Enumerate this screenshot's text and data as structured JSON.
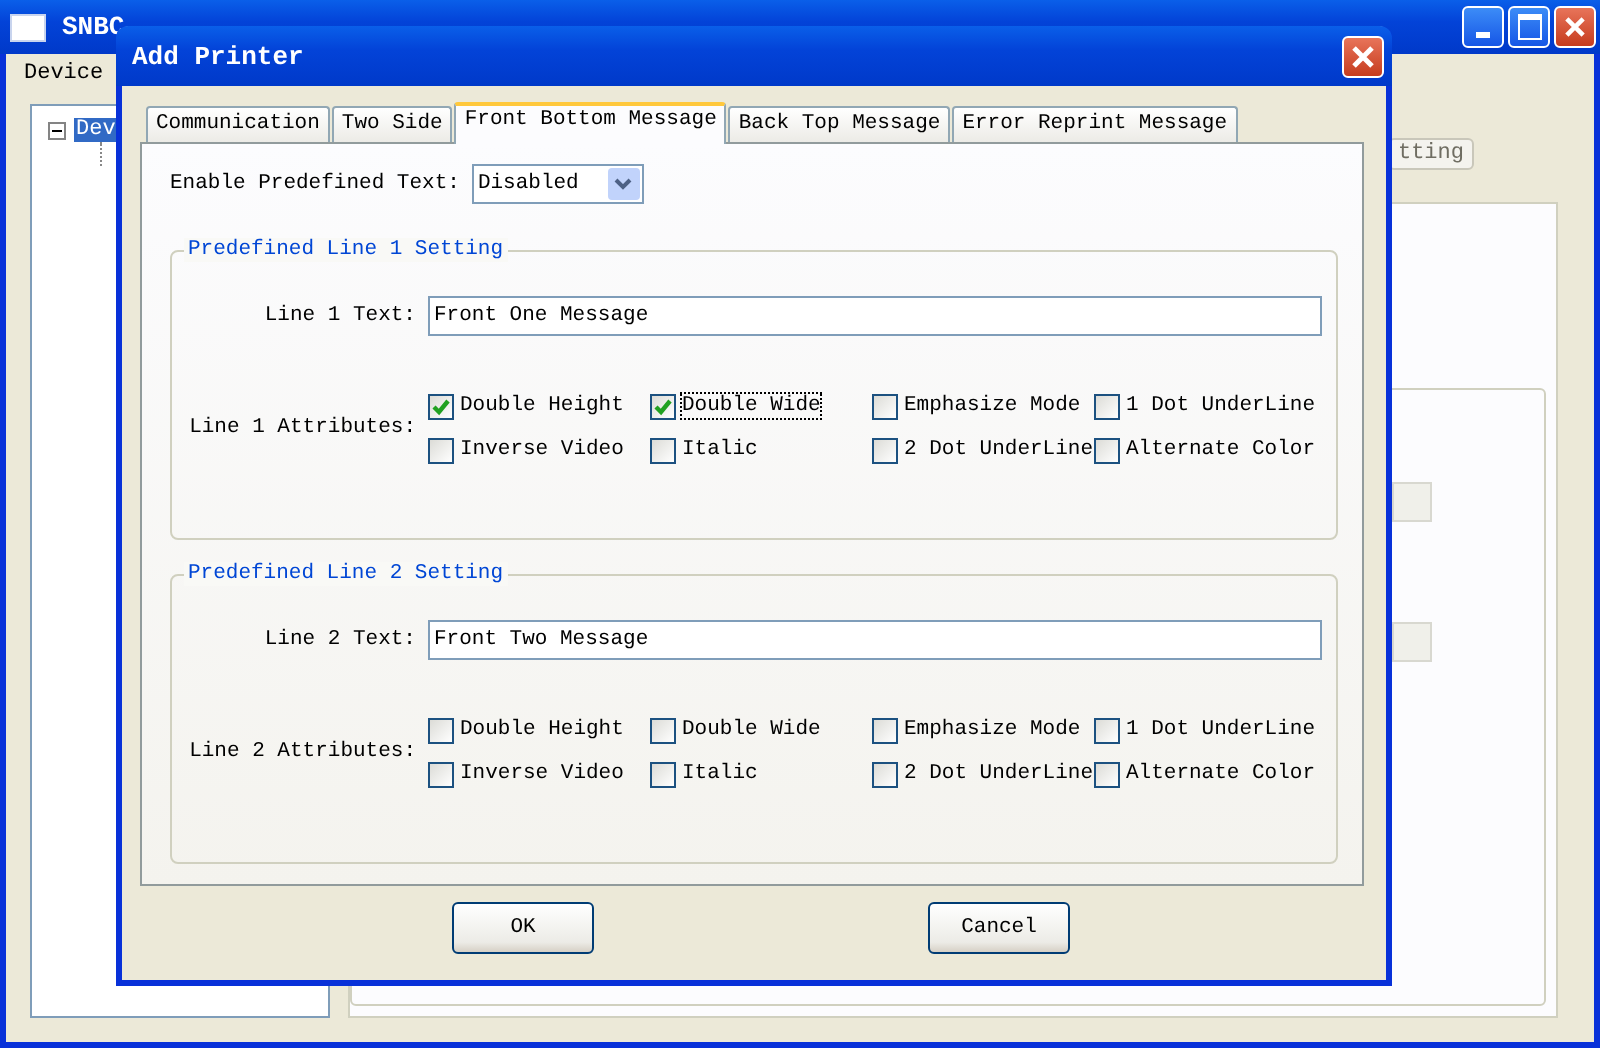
{
  "main_window": {
    "title": "SNBC",
    "menu": [
      "Device"
    ],
    "tree": {
      "label": "Dev",
      "expanded": true,
      "selected": true
    },
    "button_fragment": "tting"
  },
  "dialog": {
    "title": "Add Printer",
    "tabs": [
      {
        "label": "Communication",
        "selected": false
      },
      {
        "label": "Two Side",
        "selected": false
      },
      {
        "label": "Front Bottom Message",
        "selected": true
      },
      {
        "label": "Back Top Message",
        "selected": false
      },
      {
        "label": "Error Reprint Message",
        "selected": false
      }
    ],
    "enable_predefined": {
      "label": "Enable Predefined Text:",
      "value": "Disabled"
    },
    "groups": [
      {
        "title": "Predefined Line 1 Setting",
        "text_label": "Line 1 Text:",
        "text_value": "Front One Message",
        "attributes_label": "Line 1 Attributes:",
        "attributes": [
          {
            "label": "Double Height",
            "checked": true,
            "focused": false
          },
          {
            "label": "Double Wide",
            "checked": true,
            "focused": true
          },
          {
            "label": "Emphasize Mode",
            "checked": false,
            "focused": false
          },
          {
            "label": "1 Dot UnderLine",
            "checked": false,
            "focused": false
          },
          {
            "label": "Inverse Video",
            "checked": false,
            "focused": false
          },
          {
            "label": "Italic",
            "checked": false,
            "focused": false
          },
          {
            "label": "2 Dot UnderLine",
            "checked": false,
            "focused": false
          },
          {
            "label": "Alternate Color",
            "checked": false,
            "focused": false
          }
        ]
      },
      {
        "title": "Predefined Line 2 Setting",
        "text_label": "Line 2 Text:",
        "text_value": "Front Two Message",
        "attributes_label": "Line 2 Attributes:",
        "attributes": [
          {
            "label": "Double Height",
            "checked": false,
            "focused": false
          },
          {
            "label": "Double Wide",
            "checked": false,
            "focused": false
          },
          {
            "label": "Emphasize Mode",
            "checked": false,
            "focused": false
          },
          {
            "label": "1 Dot UnderLine",
            "checked": false,
            "focused": false
          },
          {
            "label": "Inverse Video",
            "checked": false,
            "focused": false
          },
          {
            "label": "Italic",
            "checked": false,
            "focused": false
          },
          {
            "label": "2 Dot UnderLine",
            "checked": false,
            "focused": false
          },
          {
            "label": "Alternate Color",
            "checked": false,
            "focused": false
          }
        ]
      }
    ],
    "buttons": [
      "OK",
      "Cancel"
    ]
  }
}
